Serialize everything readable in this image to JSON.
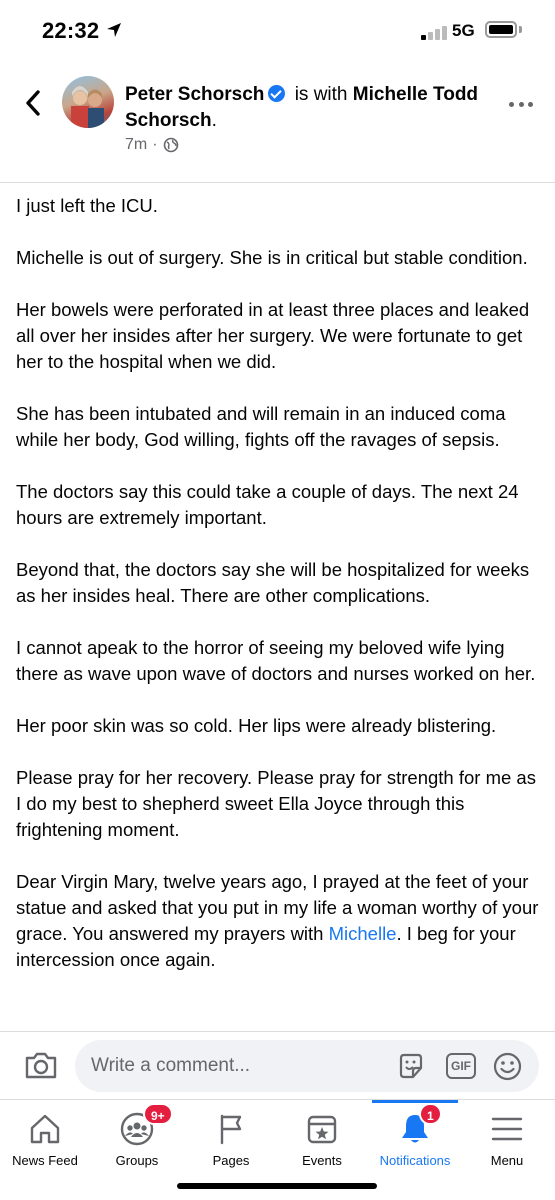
{
  "status_bar": {
    "time": "22:32",
    "network": "5G"
  },
  "header": {
    "author": "Peter  Schorsch",
    "with_text": "is with",
    "tagged": "Michelle Todd Schorsch",
    "tagged_suffix": ".",
    "timestamp": "7m",
    "separator": "·",
    "privacy_icon": "globe-icon"
  },
  "post": {
    "paragraphs": [
      "I just left the ICU.",
      "Michelle is out of surgery. She is in critical but stable condition.",
      "Her bowels were perforated in at least three places and leaked all over her insides after her surgery. We were fortunate to get her to the hospital when we did.",
      "She has been intubated and will remain in an induced coma while her body, God willing, fights off the ravages of sepsis.",
      "The doctors say this could take a couple of days. The next 24 hours are extremely important.",
      "Beyond that, the doctors say she will be hospitalized for weeks as her insides heal. There are other complications.",
      "I cannot apeak to the horror of seeing my beloved wife lying there as wave upon wave of doctors and nurses worked on her.",
      "Her poor skin was so cold. Her lips were already blistering.",
      "Please pray for her recovery. Please pray for strength for me as I do my best to shepherd sweet Ella Joyce through this frightening moment."
    ],
    "last_paragraph_start": "Dear Virgin Mary, twelve years ago, I prayed at the feet of your statue and asked that you put in my life a woman worthy of your grace. You answered my prayers with ",
    "last_paragraph_mention": "Michelle",
    "last_paragraph_end": ". I beg for your intercession once again."
  },
  "comment_bar": {
    "placeholder": "Write a comment...",
    "gif_label": "GIF"
  },
  "bottom_nav": {
    "items": [
      {
        "label": "News Feed",
        "icon": "home-icon"
      },
      {
        "label": "Groups",
        "icon": "groups-icon",
        "badge": "9+"
      },
      {
        "label": "Pages",
        "icon": "flag-icon"
      },
      {
        "label": "Events",
        "icon": "calendar-star-icon"
      },
      {
        "label": "Notifications",
        "icon": "bell-icon",
        "badge": "1"
      },
      {
        "label": "Menu",
        "icon": "hamburger-icon"
      }
    ],
    "active": "Notifications"
  },
  "colors": {
    "accent": "#1877f2",
    "badge": "#e41e3f",
    "secondary_text": "#65676b"
  }
}
